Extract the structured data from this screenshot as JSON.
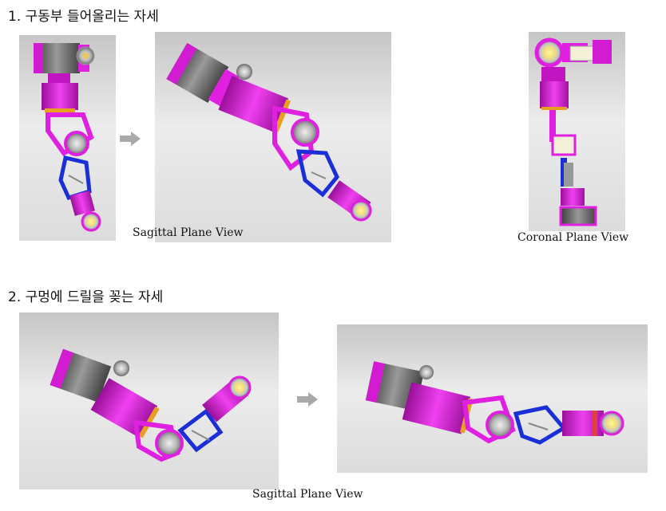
{
  "section1": {
    "heading": "1. 구동부 들어올리는 자세",
    "sagittal_caption": "Sagittal Plane View",
    "coronal_caption": "Coronal Plane View"
  },
  "section2": {
    "heading": "2. 구멍에 드릴을 꽂는 자세",
    "sagittal_caption": "Sagittal Plane View"
  },
  "colors": {
    "magenta": "#e020e0",
    "blue": "#1a2fd8",
    "gray_body": "#6d6d6d",
    "background_light": "#e9e9e9",
    "background_dark": "#c9c9c9",
    "arrow": "#a9a9a9"
  }
}
